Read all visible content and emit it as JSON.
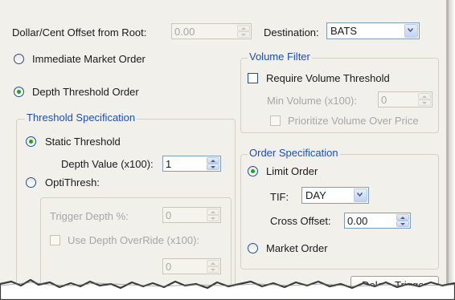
{
  "top": {
    "offset_label": "Dollar/Cent Offset from Root:",
    "offset_value": "0.00",
    "destination_label": "Destination:",
    "destination_value": "BATS"
  },
  "order_type": {
    "immediate_label": "Immediate Market Order",
    "depth_label": "Depth Threshold Order",
    "selected": "Depth Threshold Order"
  },
  "threshold": {
    "title": "Threshold Specification",
    "static_label": "Static Threshold",
    "depth_value_label": "Depth Value (x100):",
    "depth_value": "1",
    "optithresh_label": "OptiThresh:",
    "trigger_depth_label": "Trigger Depth %:",
    "trigger_depth_value": "0",
    "use_override_label": "Use Depth OverRide (x100):",
    "override_value": "0"
  },
  "volume_filter": {
    "title": "Volume Filter",
    "require_label": "Require Volume Threshold",
    "min_volume_label": "Min Volume (x100):",
    "min_volume_value": "0",
    "prioritize_label": "Prioritize Volume Over Price"
  },
  "order_spec": {
    "title": "Order Specification",
    "limit_label": "Limit Order",
    "tif_label": "TIF:",
    "tif_value": "DAY",
    "cross_offset_label": "Cross Offset:",
    "cross_offset_value": "0.00",
    "market_label": "Market Order"
  },
  "actions": {
    "delete_trigger_label": "Delete Trigger"
  },
  "colors": {
    "panel_bg": "#f1f0eb",
    "group_title": "#1b4fb8",
    "radio_selected": "#21a121",
    "input_border": "#7f9db9"
  }
}
